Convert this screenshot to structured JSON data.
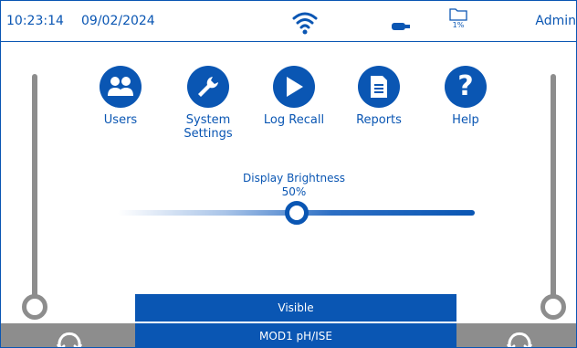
{
  "status_bar": {
    "time": "10:23:14",
    "date": "09/02/2024",
    "storage_percent": "1%",
    "user": "Admin"
  },
  "launchers": [
    {
      "label": "Users",
      "icon": "users-icon"
    },
    {
      "label": "System Settings",
      "icon": "wrench-icon"
    },
    {
      "label": "Log Recall",
      "icon": "play-icon"
    },
    {
      "label": "Reports",
      "icon": "document-icon"
    },
    {
      "label": "Help",
      "icon": "question-icon"
    }
  ],
  "brightness": {
    "title": "Display Brightness",
    "value_text": "50%",
    "value": 0.5
  },
  "bottom": {
    "visible_label": "Visible",
    "module_label": "MOD1 pH/ISE"
  },
  "colors": {
    "accent": "#0a56b3",
    "gray": "#8d8d8d"
  }
}
